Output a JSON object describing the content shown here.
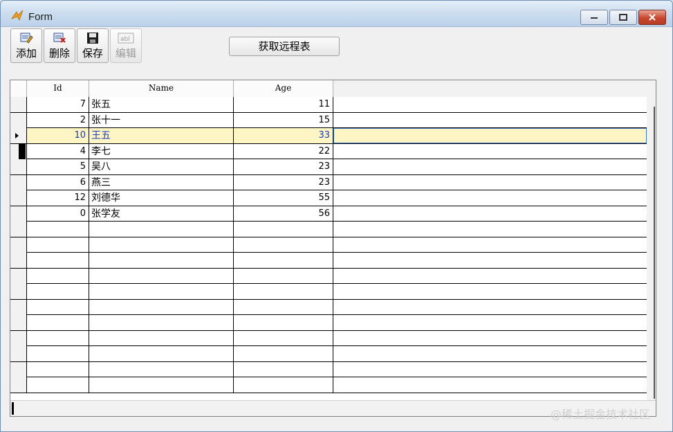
{
  "window": {
    "title": "Form"
  },
  "toolbar": {
    "add_label": "添加",
    "delete_label": "删除",
    "save_label": "保存",
    "edit_label": "编辑",
    "edit_icon_text": "abl"
  },
  "remote_button": {
    "label": "获取远程表"
  },
  "grid": {
    "headers": {
      "id": "Id",
      "name": "Name",
      "age": "Age"
    },
    "rows": [
      {
        "id": "7",
        "name": "张五",
        "age": "11"
      },
      {
        "id": "2",
        "name": "张十一",
        "age": "15"
      },
      {
        "id": "10",
        "name": "王五",
        "age": "33"
      },
      {
        "id": "4",
        "name": "李七",
        "age": "22"
      },
      {
        "id": "5",
        "name": "吴八",
        "age": "23"
      },
      {
        "id": "6",
        "name": "燕三",
        "age": "23"
      },
      {
        "id": "12",
        "name": "刘德华",
        "age": "55"
      },
      {
        "id": "0",
        "name": "张学友",
        "age": "56"
      }
    ],
    "selected_row": 2
  },
  "watermark": "@稀土掘金技术社区"
}
